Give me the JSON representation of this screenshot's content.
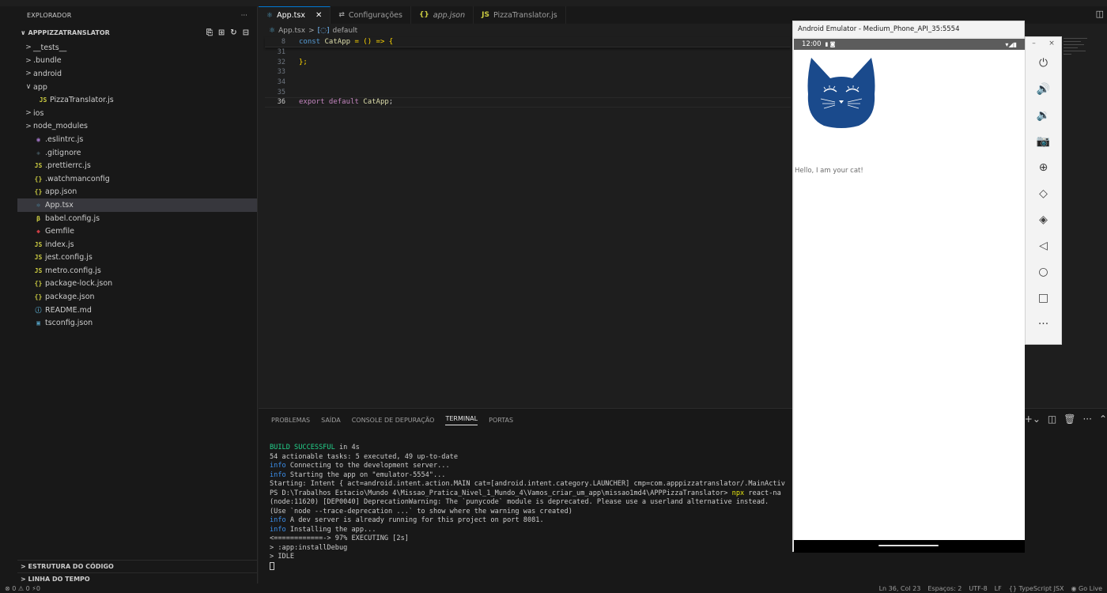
{
  "explorer": {
    "header": "EXPLORADOR",
    "header_more": "···",
    "project": "APPPIZZATRANSLATOR",
    "items": [
      {
        "arrow": ">",
        "icon": "",
        "label": "__tests__",
        "indent": 0,
        "color": "#cccccc"
      },
      {
        "arrow": ">",
        "icon": "",
        "label": ".bundle",
        "indent": 0,
        "color": "#cccccc"
      },
      {
        "arrow": ">",
        "icon": "",
        "label": "android",
        "indent": 0,
        "color": "#cccccc"
      },
      {
        "arrow": "∨",
        "icon": "",
        "label": "app",
        "indent": 0,
        "color": "#cccccc"
      },
      {
        "arrow": "",
        "icon": "JS",
        "label": "PizzaTranslator.js",
        "indent": 1,
        "color": "#cbcb41"
      },
      {
        "arrow": ">",
        "icon": "",
        "label": "ios",
        "indent": 0,
        "color": "#cccccc"
      },
      {
        "arrow": ">",
        "icon": "",
        "label": "node_modules",
        "indent": 0,
        "color": "#cccccc"
      },
      {
        "arrow": "",
        "icon": "◉",
        "label": ".eslintrc.js",
        "indent": 0,
        "color": "#a074c4"
      },
      {
        "arrow": "",
        "icon": "◈",
        "label": ".gitignore",
        "indent": 0,
        "color": "#41535b"
      },
      {
        "arrow": "",
        "icon": "JS",
        "label": ".prettierrc.js",
        "indent": 0,
        "color": "#cbcb41"
      },
      {
        "arrow": "",
        "icon": "{}",
        "label": ".watchmanconfig",
        "indent": 0,
        "color": "#cbcb41"
      },
      {
        "arrow": "",
        "icon": "{}",
        "label": "app.json",
        "indent": 0,
        "color": "#cbcb41"
      },
      {
        "arrow": "",
        "icon": "⚛",
        "label": "App.tsx",
        "indent": 0,
        "color": "#519aba",
        "selected": true
      },
      {
        "arrow": "",
        "icon": "β",
        "label": "babel.config.js",
        "indent": 0,
        "color": "#cbcb41"
      },
      {
        "arrow": "",
        "icon": "◆",
        "label": "Gemfile",
        "indent": 0,
        "color": "#cc3e44"
      },
      {
        "arrow": "",
        "icon": "JS",
        "label": "index.js",
        "indent": 0,
        "color": "#cbcb41"
      },
      {
        "arrow": "",
        "icon": "JS",
        "label": "jest.config.js",
        "indent": 0,
        "color": "#cbcb41"
      },
      {
        "arrow": "",
        "icon": "JS",
        "label": "metro.config.js",
        "indent": 0,
        "color": "#cbcb41"
      },
      {
        "arrow": "",
        "icon": "{}",
        "label": "package-lock.json",
        "indent": 0,
        "color": "#cbcb41"
      },
      {
        "arrow": "",
        "icon": "{}",
        "label": "package.json",
        "indent": 0,
        "color": "#cbcb41"
      },
      {
        "arrow": "",
        "icon": "ⓘ",
        "label": "README.md",
        "indent": 0,
        "color": "#519aba"
      },
      {
        "arrow": "",
        "icon": "▣",
        "label": "tsconfig.json",
        "indent": 0,
        "color": "#519aba"
      }
    ],
    "outline": "ESTRUTURA DO CÓDIGO",
    "timeline": "LINHA DO TEMPO"
  },
  "tabs": [
    {
      "icon": "⚛",
      "icon_color": "#519aba",
      "label": "App.tsx",
      "active": true,
      "italic": false
    },
    {
      "icon": "⇄",
      "icon_color": "#9d9d9d",
      "label": "Configurações",
      "active": false,
      "italic": false
    },
    {
      "icon": "{}",
      "icon_color": "#cbcb41",
      "label": "app.json",
      "active": false,
      "italic": true
    },
    {
      "icon": "JS",
      "icon_color": "#cbcb41",
      "label": "PizzaTranslator.js",
      "active": false,
      "italic": false
    }
  ],
  "breadcrumb": {
    "file": "App.tsx",
    "sep": ">",
    "symbol": "default"
  },
  "code": {
    "line8_num": "8",
    "line8_const": "const ",
    "line8_name": "CatApp",
    "line8_rest": " = () => {",
    "lines": [
      {
        "num": "31",
        "text": ""
      },
      {
        "num": "32",
        "text": "};"
      },
      {
        "num": "33",
        "text": ""
      },
      {
        "num": "34",
        "text": ""
      },
      {
        "num": "35",
        "text": ""
      }
    ],
    "line36_num": "36",
    "line36_export": "export default ",
    "line36_name": "CatApp",
    "line36_end": ";"
  },
  "panel": {
    "tabs": [
      "PROBLEMAS",
      "SAÍDA",
      "CONSOLE DE DEPURAÇÃO",
      "TERMINAL",
      "PORTAS"
    ],
    "active_tab": "TERMINAL",
    "terminal": [
      [
        {
          "c": "g",
          "t": "BUILD SUCCESSFUL"
        },
        {
          "c": "",
          "t": " in 4s"
        }
      ],
      [
        {
          "c": "",
          "t": "54 actionable tasks: 5 executed, 49 up-to-date"
        }
      ],
      [
        {
          "c": "b",
          "t": "info"
        },
        {
          "c": "",
          "t": " Connecting to the development server..."
        }
      ],
      [
        {
          "c": "b",
          "t": "info"
        },
        {
          "c": "",
          "t": " Starting the app on \"emulator-5554\"..."
        }
      ],
      [
        {
          "c": "",
          "t": "Starting: Intent { act=android.intent.action.MAIN cat=[android.intent.category.LAUNCHER] cmp=com.apppizzatranslator/.MainActiv"
        }
      ],
      [
        {
          "c": "",
          "t": "PS D:\\Trabalhos Estacio\\Mundo 4\\Missao_Pratica_Nivel_1_Mundo_4\\Vamos_criar_um_app\\missao1md4\\APPPizzaTranslator> "
        },
        {
          "c": "y",
          "t": "npx"
        },
        {
          "c": "",
          "t": " react-na"
        }
      ],
      [
        {
          "c": "",
          "t": "(node:11620) [DEP0040] DeprecationWarning: The `punycode` module is deprecated. Please use a userland alternative instead."
        }
      ],
      [
        {
          "c": "",
          "t": "(Use `node --trace-deprecation ...` to show where the warning was created)"
        }
      ],
      [
        {
          "c": "b",
          "t": "info"
        },
        {
          "c": "",
          "t": " A dev server is already running for this project on port 8081."
        }
      ],
      [
        {
          "c": "b",
          "t": "info"
        },
        {
          "c": "",
          "t": " Installing the app..."
        }
      ],
      [
        {
          "c": "",
          "t": "<============-> 97% EXECUTING [2s]"
        }
      ],
      [
        {
          "c": "",
          "t": "> :app:installDebug"
        }
      ],
      [
        {
          "c": "",
          "t": "> IDLE"
        }
      ]
    ]
  },
  "status": {
    "left": "⊗ 0 ⚠ 0   ⚡0",
    "position": "Ln 36, Col 23",
    "spaces": "Espaços: 2",
    "encoding": "UTF-8",
    "eol": "LF",
    "language": "{} TypeScript JSX",
    "golive": "◉ Go Live"
  },
  "emulator": {
    "title": "Android Emulator - Medium_Phone_API_35:5554",
    "time": "12:00",
    "status_icons": "▾◢▮",
    "hello_text": "Hello, I am your cat!",
    "cat_color": "#1a4a8c",
    "side_buttons": [
      "power-icon",
      "volume-up-icon",
      "volume-down-icon",
      "camera-icon",
      "zoom-icon",
      "rotate-left-icon",
      "rotate-right-icon",
      "back-icon",
      "home-icon",
      "overview-icon",
      "more-icon"
    ]
  }
}
